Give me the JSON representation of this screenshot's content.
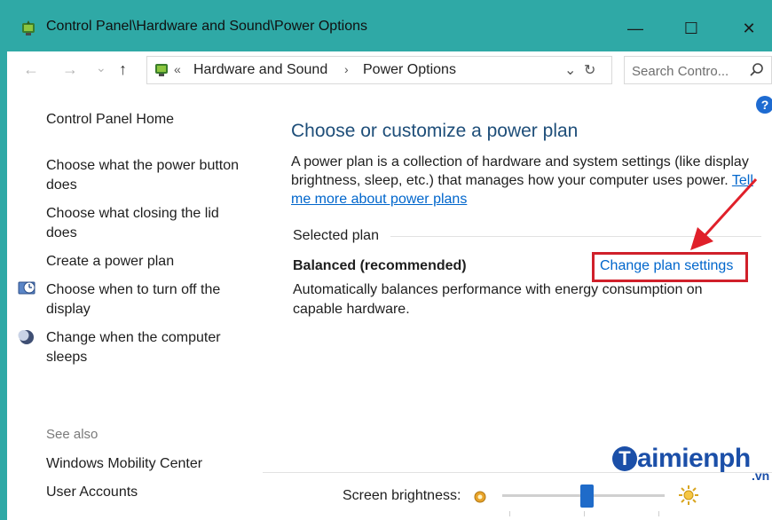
{
  "window": {
    "title": "Control Panel\\Hardware and Sound\\Power Options",
    "controls": {
      "minimize": "—",
      "maximize": "☐",
      "close": "✕"
    }
  },
  "addressbar": {
    "back": "←",
    "forward": "→",
    "recent": "⌄",
    "up": "↑",
    "overflow": "«",
    "crumbs": [
      "Hardware and Sound",
      "Power Options"
    ],
    "separator": "›",
    "dropdown": "⌄",
    "refresh": "↻"
  },
  "search": {
    "placeholder": "Search Contro...",
    "icon": "search-icon"
  },
  "help": "?",
  "sidebar": {
    "home": "Control Panel Home",
    "links": [
      {
        "label": "Choose what the power button does"
      },
      {
        "label": "Choose what closing the lid does"
      },
      {
        "label": "Create a power plan"
      },
      {
        "label": "Choose when to turn off the display",
        "icon": "display-clock-icon"
      },
      {
        "label": "Change when the computer sleeps",
        "icon": "moon-icon"
      }
    ],
    "see_also": "See also",
    "see_also_links": [
      "Windows Mobility Center",
      "User Accounts"
    ]
  },
  "main": {
    "title": "Choose or customize a power plan",
    "description": "A power plan is a collection of hardware and system settings (like display brightness, sleep, etc.) that manages how your computer uses power.",
    "learn_more": "Tell me more about power plans",
    "selected_plan_label": "Selected plan",
    "plan": {
      "name": "Balanced (recommended)",
      "change_link": "Change plan settings",
      "description": "Automatically balances performance with energy consumption on capable hardware."
    }
  },
  "brightness": {
    "label": "Screen brightness:",
    "value_percent": 52
  },
  "watermark": {
    "brand": "aimienph",
    "initial": "T",
    "suffix": ".vn"
  },
  "colors": {
    "titlebar": "#2fa9a6",
    "link": "#0066cc",
    "heading": "#1e4e79",
    "highlight": "#d0202a",
    "slider": "#1f6bc9"
  }
}
